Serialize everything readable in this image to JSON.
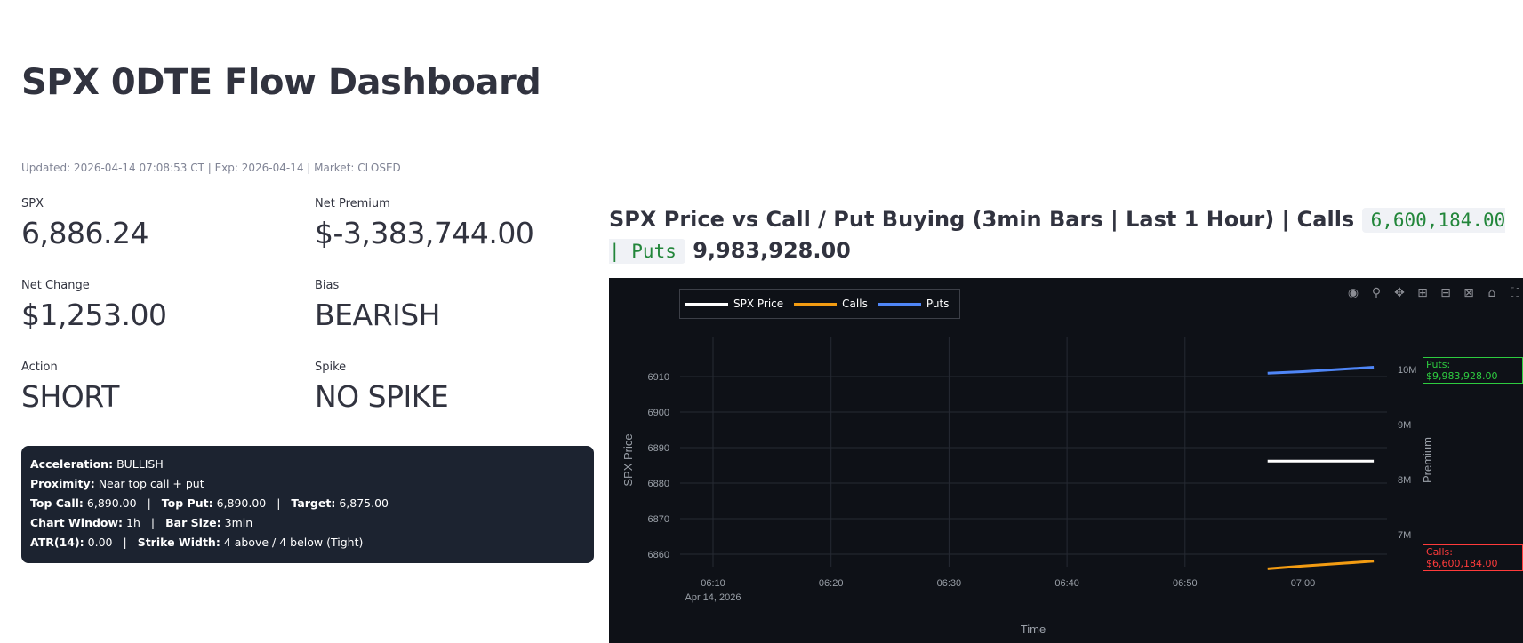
{
  "title": "SPX 0DTE Flow Dashboard",
  "updated": "Updated: 2026-04-14 07:08:53 CT | Exp: 2026-04-14 | Market: CLOSED",
  "metrics": {
    "spx": {
      "label": "SPX",
      "value": "6,886.24"
    },
    "net_premium": {
      "label": "Net Premium",
      "value": "$-3,383,744.00"
    },
    "net_change": {
      "label": "Net Change",
      "value": "$1,253.00"
    },
    "bias": {
      "label": "Bias",
      "value": "BEARISH"
    },
    "action": {
      "label": "Action",
      "value": "SHORT"
    },
    "spike": {
      "label": "Spike",
      "value": "NO SPIKE"
    }
  },
  "info": {
    "acceleration_label": "Acceleration:",
    "acceleration": "BULLISH",
    "proximity_label": "Proximity:",
    "proximity": "Near top call + put",
    "top_call_label": "Top Call:",
    "top_call": "6,890.00",
    "top_put_label": "Top Put:",
    "top_put": "6,890.00",
    "target_label": "Target:",
    "target": "6,875.00",
    "chart_window_label": "Chart Window:",
    "chart_window": "1h",
    "bar_size_label": "Bar Size:",
    "bar_size": "3min",
    "atr_label": "ATR(14):",
    "atr": "0.00",
    "strike_width_label": "Strike Width:",
    "strike_width": "4 above / 4 below (Tight)",
    "separator": "|"
  },
  "chart_heading": {
    "prefix": "SPX Price vs Call / Put Buying (3min Bars | Last 1 Hour) | Calls",
    "code": "6,600,184.00 | Puts",
    "suffix": "9,983,928.00"
  },
  "colors": {
    "spx": "#ffffff",
    "calls": "#f39c12",
    "puts": "#4f86f7",
    "puts_tag": "#2ecc40",
    "calls_tag": "#ff3b3b"
  },
  "chart_data": {
    "type": "line",
    "xlabel": "Time",
    "ylabel": "SPX Price",
    "y2label": "Premium",
    "x_ticks": [
      "06:10",
      "06:20",
      "06:30",
      "06:40",
      "06:50",
      "07:00"
    ],
    "x_date": "Apr 14, 2026",
    "y_ticks": [
      6860,
      6870,
      6880,
      6890,
      6900,
      6910
    ],
    "y2_ticks": [
      "7M",
      "8M",
      "9M",
      "10M"
    ],
    "ylim": [
      6856,
      6918
    ],
    "y2lim": [
      6500000,
      10500000
    ],
    "x_minutes": [
      6.7,
      7.2,
      7.7
    ],
    "series": [
      {
        "name": "SPX Price",
        "axis": "y",
        "x": [
          "06:57",
          "07:00",
          "07:06"
        ],
        "values": [
          6886.2,
          6886.2,
          6886.2
        ]
      },
      {
        "name": "Calls",
        "axis": "y2",
        "x": [
          "06:57",
          "07:00",
          "07:06"
        ],
        "values": [
          6380000,
          6430000,
          6520000
        ]
      },
      {
        "name": "Puts",
        "axis": "y2",
        "x": [
          "06:57",
          "07:00",
          "07:06"
        ],
        "values": [
          9930000,
          9960000,
          10040000
        ]
      }
    ],
    "annotations": {
      "puts": "Puts: $9,983,928.00",
      "calls": "Calls: $6,600,184.00"
    },
    "legend": "top-left"
  }
}
